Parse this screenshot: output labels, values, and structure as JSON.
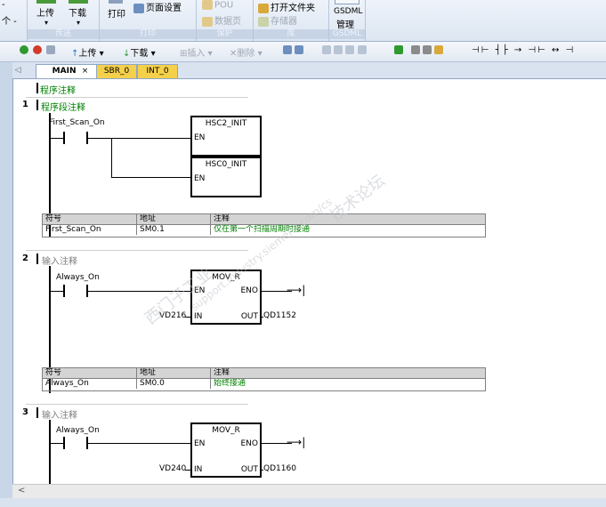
{
  "ribbon": {
    "left_items": [
      "-",
      "个 -"
    ],
    "transfer": {
      "upload": "上传",
      "download": "下载",
      "caption": "传送"
    },
    "print": {
      "print": "打印",
      "page_setup": "页面设置",
      "caption": "打印"
    },
    "protect": {
      "pou": "POU",
      "data_page": "数据页",
      "caption": "保护"
    },
    "library": {
      "open_folder": "打开文件夹",
      "memory": "存储器",
      "caption": "库"
    },
    "gsdml": {
      "label_line1": "GSDML",
      "label_line2": "管理",
      "caption": "GSDML"
    }
  },
  "toolbar": {
    "upload": "上传",
    "download": "下载",
    "insert": "插入",
    "delete": "删除"
  },
  "tabs": [
    {
      "label": "MAIN",
      "close": "×",
      "active": true
    },
    {
      "label": "SBR_0",
      "active": false
    },
    {
      "label": "INT_0",
      "active": false
    }
  ],
  "program": {
    "comment": "程序注释",
    "networks": [
      {
        "number": "1",
        "comment": "程序段注释",
        "contact": "First_Scan_On",
        "boxes": [
          {
            "title": "HSC2_INIT",
            "en": "EN"
          },
          {
            "title": "HSC0_INIT",
            "en": "EN"
          }
        ],
        "symbol_table": {
          "headers": [
            "符号",
            "地址",
            "注释"
          ],
          "rows": [
            [
              "First_Scan_On",
              "SM0.1",
              "仅在第一个扫描周期时接通"
            ]
          ]
        }
      },
      {
        "number": "2",
        "comment": "输入注释",
        "contact": "Always_On",
        "box": {
          "title": "MOV_R",
          "en": "EN",
          "eno": "ENO",
          "in": "IN",
          "out": "OUT",
          "in_operand": "VD216",
          "out_operand": "QD1152"
        },
        "symbol_table": {
          "headers": [
            "符号",
            "地址",
            "注释"
          ],
          "rows": [
            [
              "Always_On",
              "SM0.0",
              "始终接通"
            ]
          ]
        }
      },
      {
        "number": "3",
        "comment": "输入注释",
        "contact": "Always_On",
        "box": {
          "title": "MOV_R",
          "en": "EN",
          "eno": "ENO",
          "in": "IN",
          "out": "OUT",
          "in_operand": "VD240",
          "out_operand": "QD1160"
        }
      }
    ]
  },
  "scrollbar": {
    "left_arrow": "<"
  },
  "watermark": {
    "line1": "西门子工业",
    "line2": "技术论坛",
    "line3": "support.industry.siemens.com/cs"
  }
}
